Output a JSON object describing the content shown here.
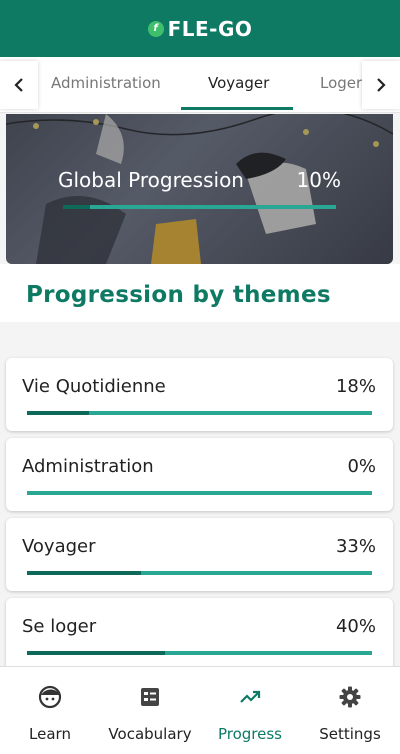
{
  "app": {
    "logo_badge": "f",
    "title": "FLE-GO"
  },
  "tabs": {
    "items": [
      {
        "label": "Administration"
      },
      {
        "label": "Voyager"
      },
      {
        "label": "Loger"
      }
    ],
    "active": "Voyager"
  },
  "global": {
    "label": "Global Progression",
    "value": "10%",
    "fraction": 0.1
  },
  "section": {
    "title": "Progression by themes"
  },
  "themes": [
    {
      "name": "Vie Quotidienne",
      "pct": "18%",
      "fraction": 0.18
    },
    {
      "name": "Administration",
      "pct": "0%",
      "fraction": 0.0
    },
    {
      "name": "Voyager",
      "pct": "33%",
      "fraction": 0.33
    },
    {
      "name": "Se loger",
      "pct": "40%",
      "fraction": 0.4
    }
  ],
  "nav": {
    "items": [
      {
        "label": "Learn",
        "icon": "face-icon"
      },
      {
        "label": "Vocabulary",
        "icon": "vocabulary-list-icon"
      },
      {
        "label": "Progress",
        "icon": "trending-up-icon"
      },
      {
        "label": "Settings",
        "icon": "gear-icon"
      }
    ],
    "active": "Progress"
  },
  "colors": {
    "primary": "#0e7a64",
    "track": "#2aa694",
    "fill": "#0e6a58"
  }
}
